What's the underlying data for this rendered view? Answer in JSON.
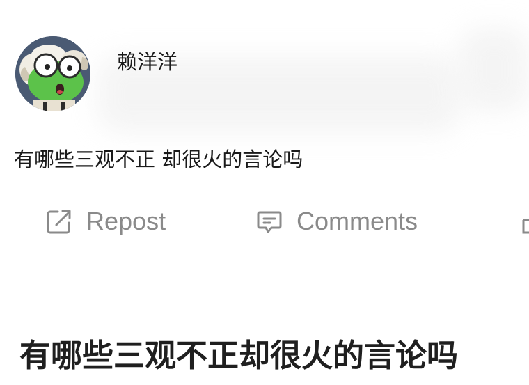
{
  "author": {
    "name": "赖洋洋"
  },
  "post": {
    "text": "有哪些三观不正 却很火的言论吗"
  },
  "actions": {
    "repost_label": "Repost",
    "comments_label": "Comments"
  },
  "headline": {
    "text": "有哪些三观不正却很火的言论吗"
  },
  "icons": {
    "repost": "edit-square-icon",
    "comments": "comment-bubble-icon",
    "like": "like-icon"
  },
  "colors": {
    "action_gray": "#8a8a8a",
    "text": "#1a1a1a",
    "avatar_bg": "#4a5a73",
    "frog_green": "#5cc24a"
  }
}
